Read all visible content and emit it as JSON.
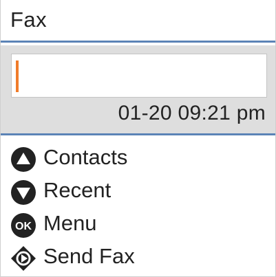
{
  "header": {
    "title": "Fax"
  },
  "entry": {
    "number_value": "",
    "datetime": "01-20 09:21 pm"
  },
  "menu": {
    "items": [
      {
        "label": "Contacts",
        "icon": "up-triangle-button-icon"
      },
      {
        "label": "Recent",
        "icon": "down-triangle-button-icon"
      },
      {
        "label": "Menu",
        "icon": "ok-button-icon"
      },
      {
        "label": "Send Fax",
        "icon": "start-diamond-button-icon"
      }
    ]
  },
  "colors": {
    "divider": "#5b83b6",
    "cursor": "#f07b2a",
    "panel": "#dedede",
    "icon": "#222222"
  }
}
